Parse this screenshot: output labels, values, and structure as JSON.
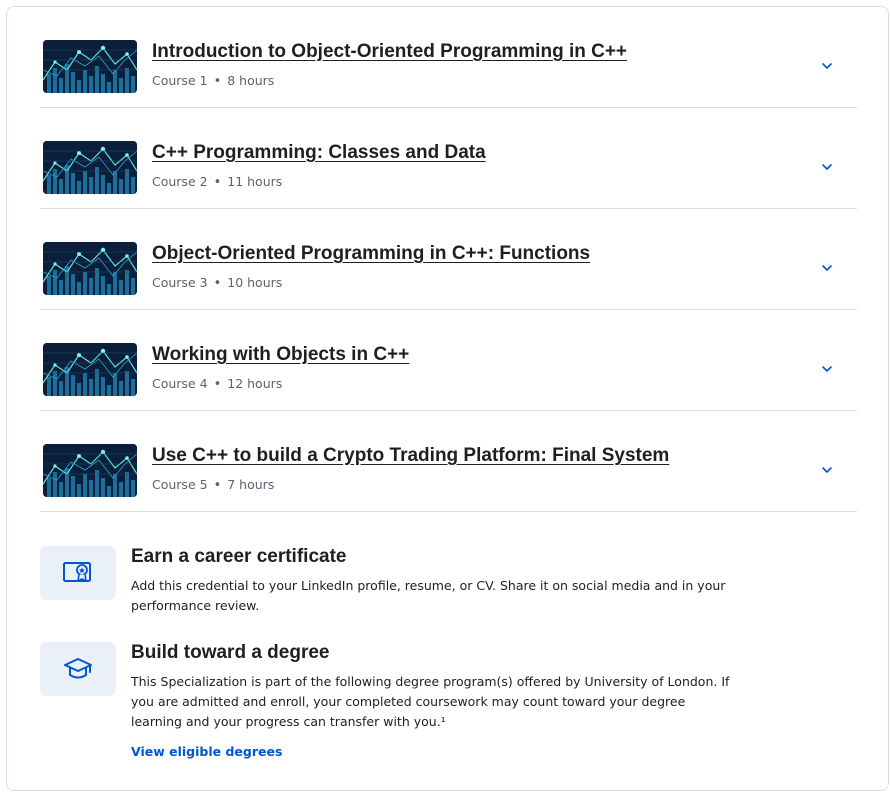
{
  "courses": [
    {
      "title": "Introduction to Object-Oriented Programming in C++",
      "number": "Course 1",
      "separator": "•",
      "duration": "8 hours"
    },
    {
      "title": "C++ Programming: Classes and Data",
      "number": "Course 2",
      "separator": "•",
      "duration": "11 hours"
    },
    {
      "title": "Object-Oriented Programming in C++: Functions",
      "number": "Course 3",
      "separator": "•",
      "duration": "10 hours"
    },
    {
      "title": "Working with Objects in C++",
      "number": "Course 4",
      "separator": "•",
      "duration": "12 hours"
    },
    {
      "title": "Use C++ to build a Crypto Trading Platform: Final System",
      "number": "Course 5",
      "separator": "•",
      "duration": "7 hours"
    }
  ],
  "certificate": {
    "title": "Earn a career certificate",
    "description": "Add this credential to your LinkedIn profile, resume, or CV. Share it on social media and in your performance review."
  },
  "degree": {
    "title": "Build toward a degree",
    "description": "This Specialization is part of the following degree program(s) offered by University of London. If you are admitted and enroll, your completed coursework may count toward your degree learning and your progress can transfer with you.¹",
    "link_label": "View eligible degrees"
  },
  "colors": {
    "link": "#0056d2",
    "icon_box": "#eaf0f8",
    "icon_stroke": "#0056d2",
    "chevron": "#0056d2",
    "divider": "#dcdcdc"
  },
  "icons": {
    "course_thumbnail": "crypto-chart-thumbnail",
    "expand": "chevron-down-icon",
    "certificate": "certificate-icon",
    "degree": "graduation-cap-icon"
  }
}
